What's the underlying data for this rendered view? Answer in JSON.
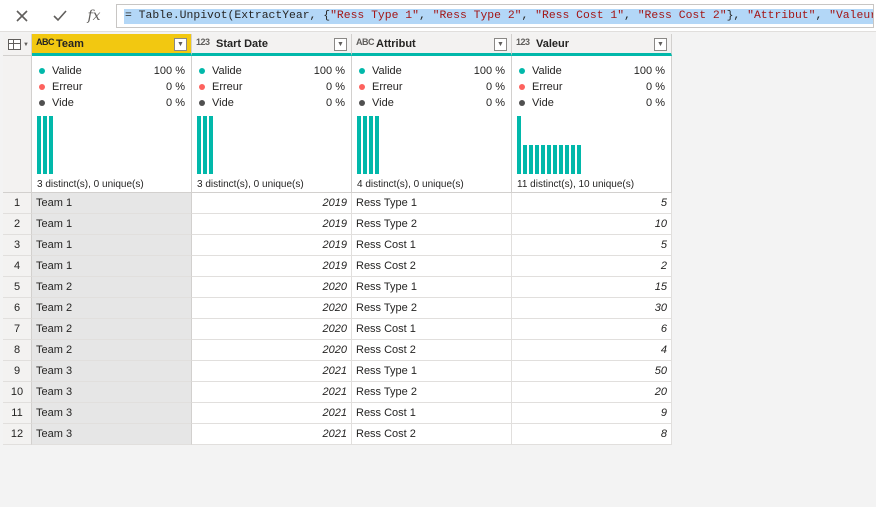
{
  "formula": {
    "cancel_icon": "close-icon",
    "accept_icon": "check-icon",
    "fx_label": "fx",
    "tokens": [
      {
        "t": "= ",
        "k": "op"
      },
      {
        "t": "Table.Unpivot(ExtractYear, {",
        "k": "fn"
      },
      {
        "t": "\"Ress Type 1\"",
        "k": "str"
      },
      {
        "t": ", ",
        "k": "op"
      },
      {
        "t": "\"Ress Type 2\"",
        "k": "str"
      },
      {
        "t": ", ",
        "k": "op"
      },
      {
        "t": "\"Ress Cost 1\"",
        "k": "str"
      },
      {
        "t": ", ",
        "k": "op"
      },
      {
        "t": "\"Ress Cost 2\"",
        "k": "str"
      },
      {
        "t": "}, ",
        "k": "op"
      },
      {
        "t": "\"Attribut\"",
        "k": "str"
      },
      {
        "t": ", ",
        "k": "op"
      },
      {
        "t": "\"Valeur\"",
        "k": "str"
      },
      {
        "t": ")",
        "k": "op"
      }
    ]
  },
  "columns": [
    {
      "name": "Team",
      "type_icon": "ABC",
      "type_name": "text-type-icon",
      "selected": true,
      "align": "left",
      "quality": {
        "valid": "100 %",
        "error": "0 %",
        "empty": "0 %"
      },
      "distinct_text": "3 distinct(s), 0 unique(s)",
      "dist": [
        1,
        1,
        1
      ]
    },
    {
      "name": "Start Date",
      "type_icon": "123",
      "type_name": "number-type-icon",
      "selected": false,
      "align": "right",
      "quality": {
        "valid": "100 %",
        "error": "0 %",
        "empty": "0 %"
      },
      "distinct_text": "3 distinct(s), 0 unique(s)",
      "dist": [
        1,
        1,
        1
      ]
    },
    {
      "name": "Attribut",
      "type_icon": "ABC",
      "type_name": "text-type-icon",
      "selected": false,
      "align": "left",
      "quality": {
        "valid": "100 %",
        "error": "0 %",
        "empty": "0 %"
      },
      "distinct_text": "4 distinct(s), 0 unique(s)",
      "dist": [
        1,
        1,
        1,
        1
      ]
    },
    {
      "name": "Valeur",
      "type_icon": "123",
      "type_name": "number-type-icon",
      "selected": false,
      "align": "right",
      "quality": {
        "valid": "100 %",
        "error": "0 %",
        "empty": "0 %"
      },
      "distinct_text": "11 distinct(s), 10 unique(s)",
      "dist": [
        1,
        0.5,
        0.5,
        0.5,
        0.5,
        0.5,
        0.5,
        0.5,
        0.5,
        0.5,
        0.5
      ]
    }
  ],
  "quality_labels": {
    "valid": "Valide",
    "error": "Erreur",
    "empty": "Vide"
  },
  "quality_colors": {
    "valid": "#01b8aa",
    "error": "#fd625e",
    "empty": "#505050"
  },
  "rows": [
    [
      "1",
      "Team 1",
      "2019",
      "Ress Type 1",
      "5"
    ],
    [
      "2",
      "Team 1",
      "2019",
      "Ress Type 2",
      "10"
    ],
    [
      "3",
      "Team 1",
      "2019",
      "Ress Cost 1",
      "5"
    ],
    [
      "4",
      "Team 1",
      "2019",
      "Ress Cost 2",
      "2"
    ],
    [
      "5",
      "Team 2",
      "2020",
      "Ress Type 1",
      "15"
    ],
    [
      "6",
      "Team 2",
      "2020",
      "Ress Type 2",
      "30"
    ],
    [
      "7",
      "Team 2",
      "2020",
      "Ress Cost 1",
      "6"
    ],
    [
      "8",
      "Team 2",
      "2020",
      "Ress Cost 2",
      "4"
    ],
    [
      "9",
      "Team 3",
      "2021",
      "Ress Type 1",
      "50"
    ],
    [
      "10",
      "Team 3",
      "2021",
      "Ress Type 2",
      "20"
    ],
    [
      "11",
      "Team 3",
      "2021",
      "Ress Cost 1",
      "9"
    ],
    [
      "12",
      "Team 3",
      "2021",
      "Ress Cost 2",
      "8"
    ]
  ]
}
